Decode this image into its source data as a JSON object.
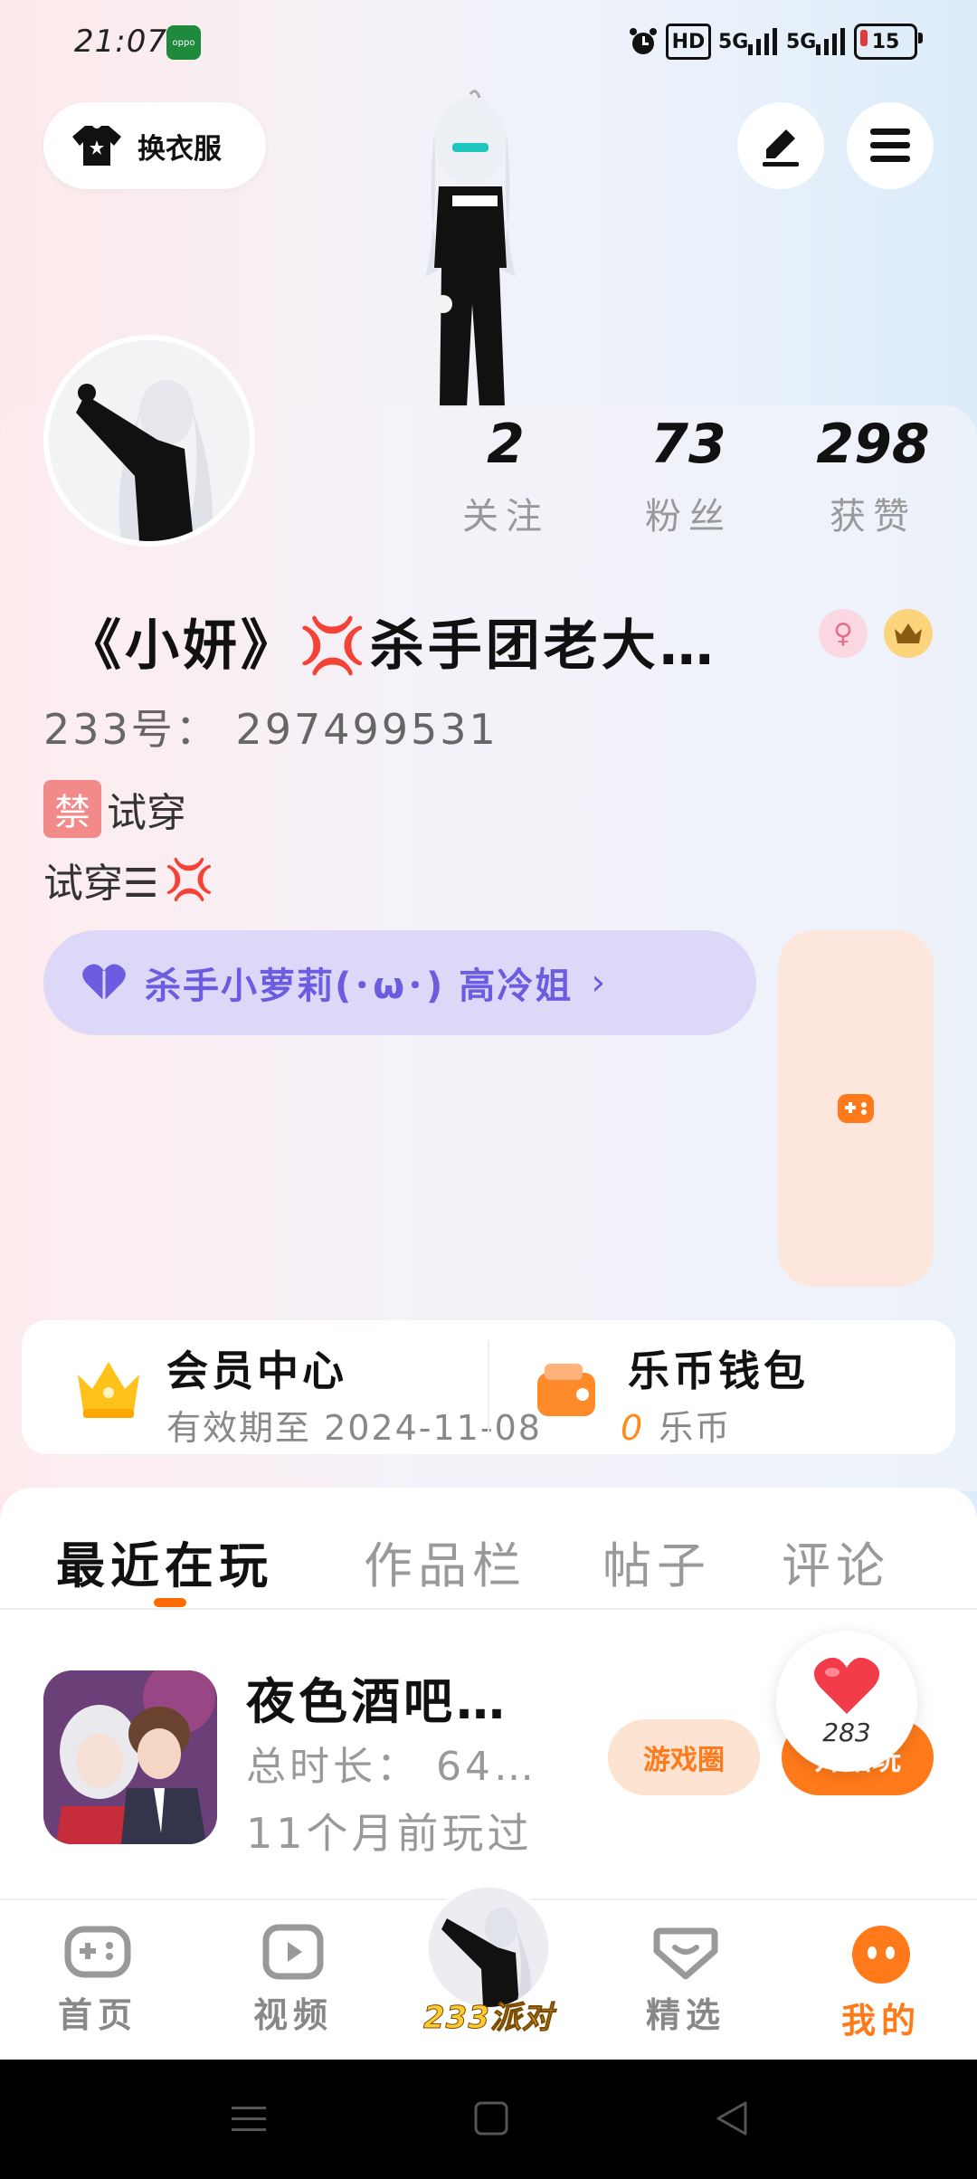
{
  "status_bar": {
    "time": "21:07",
    "carrier_icon": "oppo",
    "hd": "HD",
    "net1": "5G",
    "net2": "5G",
    "battery": "15"
  },
  "top": {
    "outfit_label": "换衣服",
    "edit_icon": "pencil-icon",
    "menu_icon": "hamburger-icon"
  },
  "stats": [
    {
      "value": "2",
      "label": "关注"
    },
    {
      "value": "73",
      "label": "粉丝"
    },
    {
      "value": "298",
      "label": "获赞"
    }
  ],
  "profile": {
    "name": "《小妍》",
    "name_emoji": "💢",
    "name_rest": "杀手团老大…",
    "uid": "233号： 297499531",
    "bio_line1_tag": "禁",
    "bio_line1": "试穿",
    "bio_line2": "试穿☰",
    "bio_line2_emoji": "💢",
    "relation": "杀手小萝莉(･ω･) 高冷姐",
    "relation_chevron": "›"
  },
  "member": {
    "title": "会员中心",
    "subtitle": "有效期至 2024-11-08"
  },
  "wallet": {
    "title": "乐币钱包",
    "amount": "0",
    "unit": "乐币"
  },
  "tabs": [
    {
      "label": "最近在玩",
      "active": true
    },
    {
      "label": "作品栏",
      "active": false
    },
    {
      "label": "帖子",
      "active": false
    },
    {
      "label": "评论",
      "active": false
    }
  ],
  "recent_game": {
    "title": "夜色酒吧…",
    "duration": "总时长： 64…",
    "last_played": "11个月前玩过",
    "circle_button": "游戏圈",
    "play_button": "开始玩",
    "like_count": "283"
  },
  "bottom_nav": [
    {
      "label": "首页",
      "icon": "gamepad-icon"
    },
    {
      "label": "视频",
      "icon": "video-play-icon"
    },
    {
      "label": "233派对",
      "icon": "party-avatar"
    },
    {
      "label": "精选",
      "icon": "heart-tv-icon"
    },
    {
      "label": "我的",
      "icon": "smile-face-icon",
      "active": true
    }
  ],
  "colors": {
    "accent": "#ff7a1a",
    "relation_bg": "#ddd8f7",
    "relation_text": "#6b5ce0",
    "like_red": "#f23c4a"
  }
}
